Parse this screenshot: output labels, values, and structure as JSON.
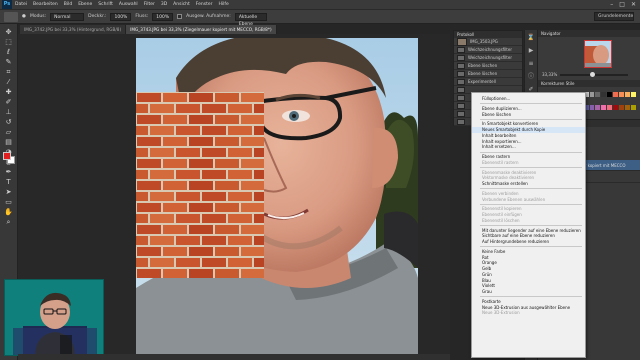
{
  "app": {
    "logo": "Ps"
  },
  "menu": [
    "Datei",
    "Bearbeiten",
    "Bild",
    "Ebene",
    "Schrift",
    "Auswahl",
    "Filter",
    "3D",
    "Ansicht",
    "Fenster",
    "Hilfe"
  ],
  "window_controls": [
    "–",
    "□",
    "✕"
  ],
  "options_bar": {
    "modus_label": "Modus:",
    "modus_value": "Normal",
    "deckkraft_label": "Deckkr.:",
    "deckkraft_value": "100%",
    "fluss_label": "Fluss:",
    "fluss_value": "100%",
    "ausrichten_label": "Ausgew. Aufnahme:",
    "sample_value": "Aktuelle Ebene",
    "workspace": "Grundelemente"
  },
  "tabs": [
    {
      "label": "IMG_3742.JPG bei 33,3% (Hintergrund, RGB/8)",
      "active": false
    },
    {
      "label": "IMG_3743.JPG bei 33,3% (Ziegelmauer kopiert mit MECCO, RGB/8*)",
      "active": true
    }
  ],
  "right_panel": {
    "tab": "Protokoll",
    "rows": [
      "IMG_3503.JPG",
      "Weichzeichnungsfilter",
      "Weichzeichnungsfilter",
      "Ebene löschen",
      "Ebene löschen",
      "Experimentell",
      "",
      "",
      "",
      "",
      ""
    ]
  },
  "navigator": {
    "tab": "Navigator",
    "zoom": "33,33%"
  },
  "correction": {
    "tabs": "Korrekturen   Stile"
  },
  "layers_panel": {
    "head": "Ebenen",
    "rows": [
      "Art",
      "Normal   Deckkr.: 100%",
      "Fixieren:    Fläche: 100%"
    ],
    "layers": [
      {
        "name": "Ziegelmauer kopiert mit MECCO",
        "selected": true
      },
      {
        "name": "Hintergrund",
        "selected": false
      }
    ]
  },
  "context_menu": {
    "items": [
      {
        "label": "Fülloptionen...",
        "state": "enabled"
      },
      {
        "sep": true
      },
      {
        "label": "Ebene duplizieren...",
        "state": "enabled"
      },
      {
        "label": "Ebene löschen",
        "state": "enabled"
      },
      {
        "sep": true
      },
      {
        "label": "In Smartobjekt konvertieren",
        "state": "enabled"
      },
      {
        "label": "Neues Smartobjekt durch Kopie",
        "state": "hover"
      },
      {
        "label": "Inhalt bearbeiten",
        "state": "enabled"
      },
      {
        "label": "Inhalt exportieren...",
        "state": "enabled"
      },
      {
        "label": "Inhalt ersetzen...",
        "state": "enabled"
      },
      {
        "sep": true
      },
      {
        "label": "Ebene rastern",
        "state": "enabled"
      },
      {
        "label": "Ebenenstil rastern",
        "state": "disabled"
      },
      {
        "sep": true
      },
      {
        "label": "Ebenenmaske deaktivieren",
        "state": "disabled"
      },
      {
        "label": "Vektormaske deaktivieren",
        "state": "disabled"
      },
      {
        "label": "Schnittmaske erstellen",
        "state": "enabled"
      },
      {
        "sep": true
      },
      {
        "label": "Ebenen verbinden",
        "state": "disabled"
      },
      {
        "label": "Verbundene Ebenen auswählen",
        "state": "disabled"
      },
      {
        "sep": true
      },
      {
        "label": "Ebenenstil kopieren",
        "state": "disabled"
      },
      {
        "label": "Ebenenstil einfügen",
        "state": "disabled"
      },
      {
        "label": "Ebenenstil löschen",
        "state": "disabled"
      },
      {
        "sep": true
      },
      {
        "label": "Mit darunter liegender auf eine Ebene reduzieren",
        "state": "enabled"
      },
      {
        "label": "Sichtbare auf eine Ebene reduzieren",
        "state": "enabled"
      },
      {
        "label": "Auf Hintergrundebene reduzieren",
        "state": "enabled"
      },
      {
        "sep": true
      },
      {
        "label": "Keine Farbe",
        "state": "enabled"
      },
      {
        "label": "Rot",
        "state": "enabled"
      },
      {
        "label": "Orange",
        "state": "enabled"
      },
      {
        "label": "Gelb",
        "state": "enabled"
      },
      {
        "label": "Grün",
        "state": "enabled"
      },
      {
        "label": "Blau",
        "state": "enabled"
      },
      {
        "label": "Violett",
        "state": "enabled"
      },
      {
        "label": "Grau",
        "state": "enabled"
      },
      {
        "sep": true
      },
      {
        "label": "Postkarte",
        "state": "enabled"
      },
      {
        "label": "Neue 3D-Extrusion aus ausgewählter Ebene",
        "state": "enabled"
      },
      {
        "label": "Neue 3D-Extrusion",
        "state": "disabled"
      }
    ]
  },
  "colors": {
    "foreground": "#e02020",
    "background": "#ffffff",
    "menu_hover": "#d6e6f7",
    "layer_selected": "#3d5f85"
  }
}
